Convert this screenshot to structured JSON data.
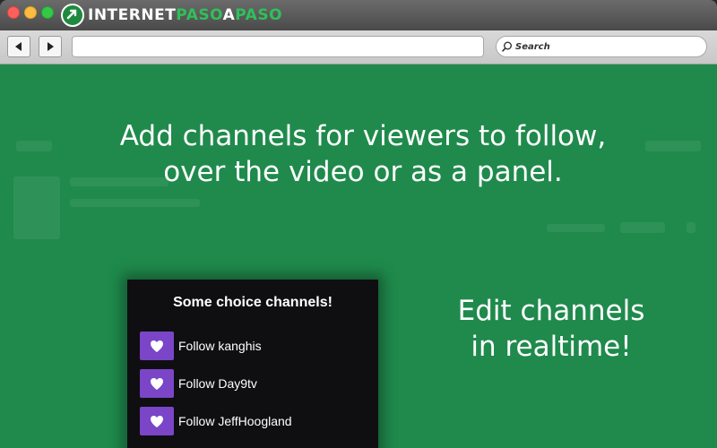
{
  "brand": {
    "part1": "INTERNET",
    "part2": "PASO",
    "part3": "A",
    "part4": "PASO",
    "accent_color": "#2fc05a"
  },
  "toolbar": {
    "search_placeholder": "Search",
    "back_icon": "back-arrow-icon",
    "forward_icon": "forward-arrow-icon"
  },
  "content": {
    "background_color": "#1f8a4c",
    "headline_line1": "Add channels for viewers to follow,",
    "headline_line2": "over the video or as a panel.",
    "side_line1": "Edit channels",
    "side_line2": "in realtime!"
  },
  "panel": {
    "title": "Some choice channels!",
    "button_color": "#7b45c8",
    "items": [
      {
        "label": "Follow kanghis",
        "icon": "heart-icon"
      },
      {
        "label": "Follow Day9tv",
        "icon": "heart-icon"
      },
      {
        "label": "Follow JeffHoogland",
        "icon": "heart-icon"
      }
    ]
  }
}
